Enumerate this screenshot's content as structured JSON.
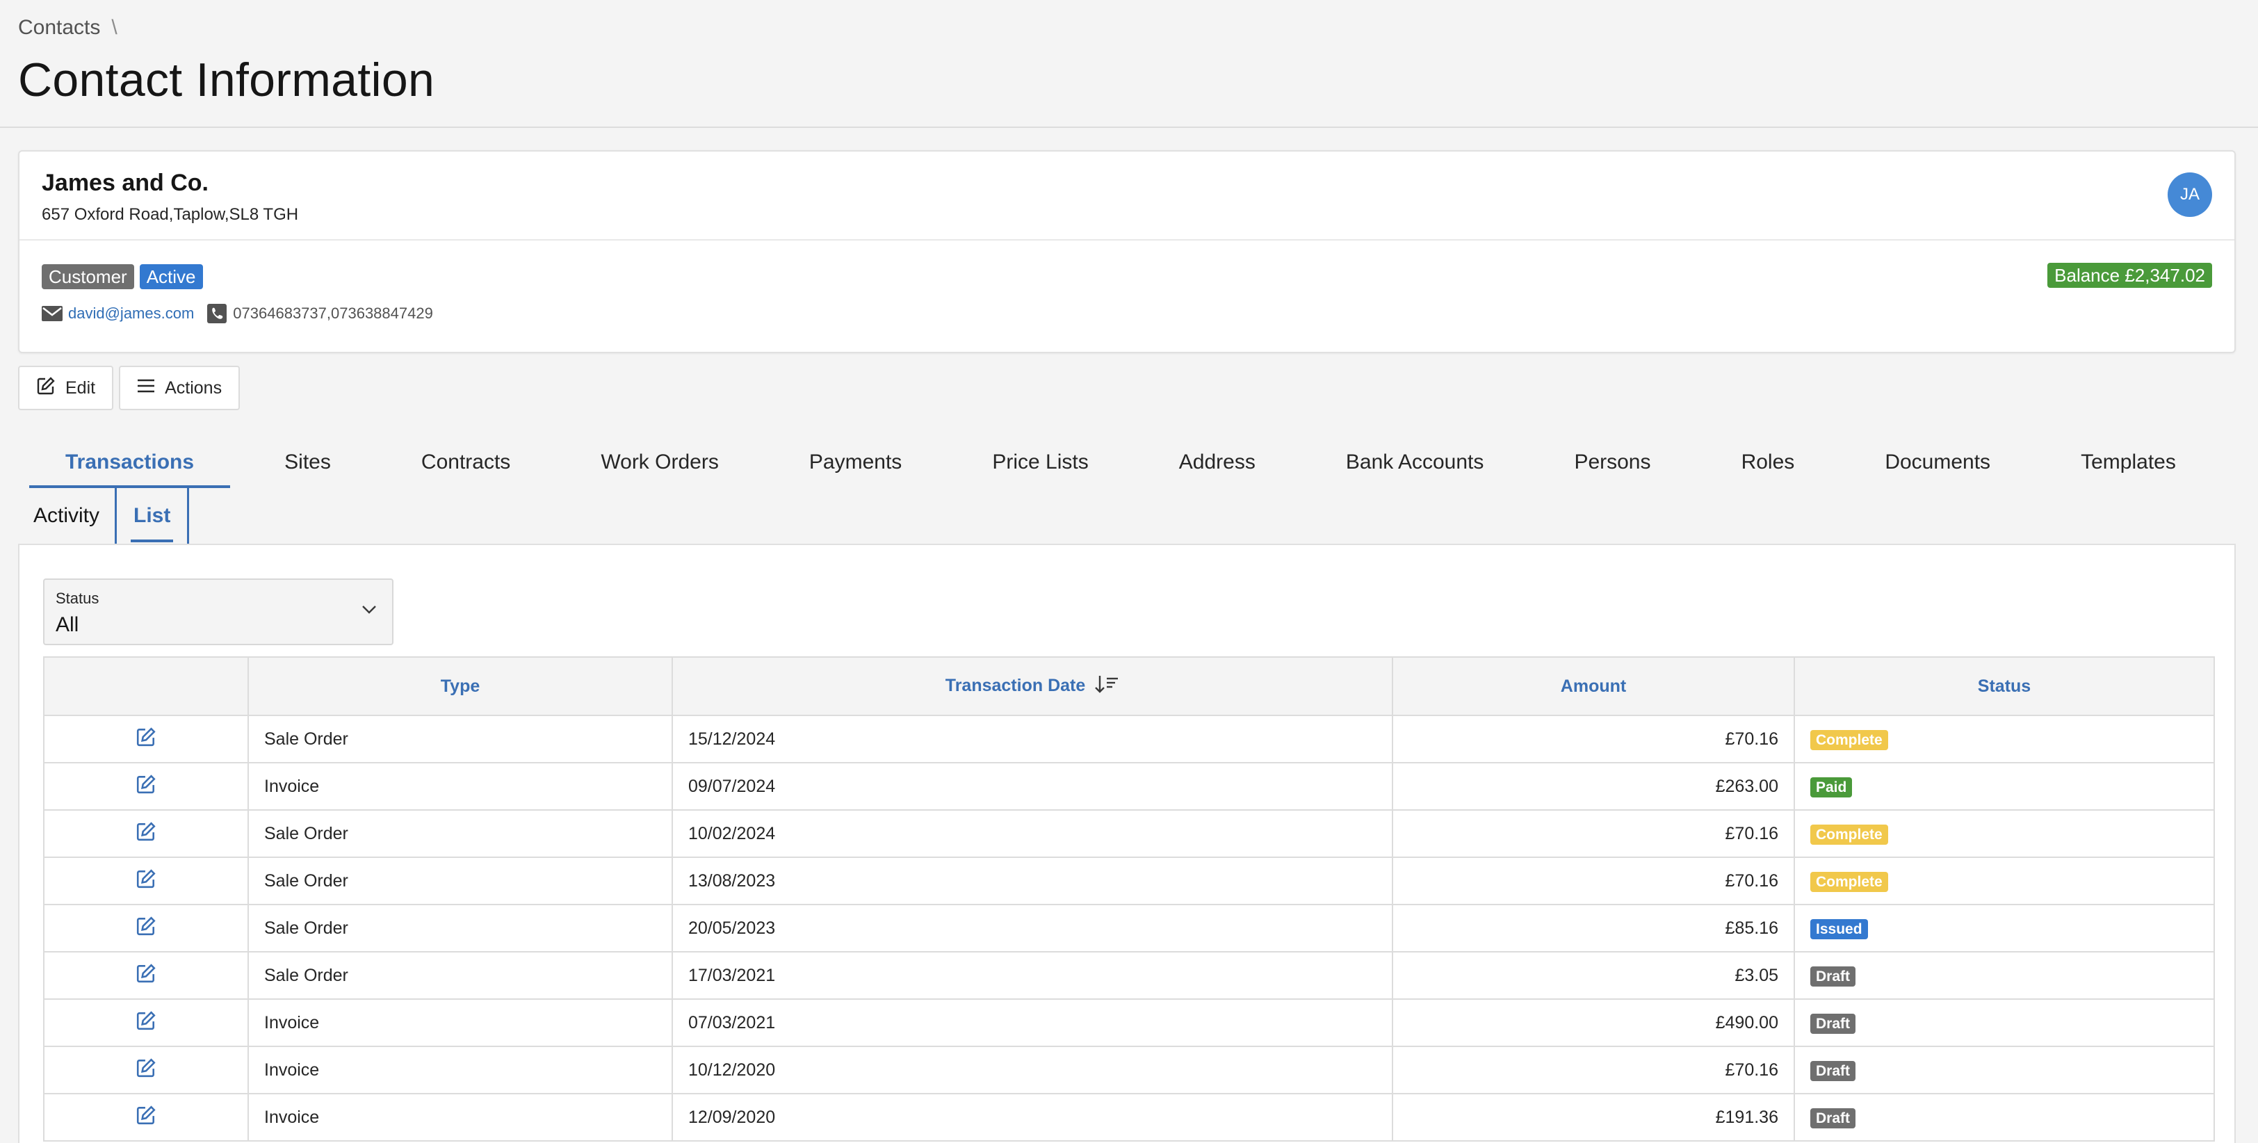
{
  "header": {
    "breadcrumb": [
      "Contacts"
    ],
    "breadcrumb_sep": "\\",
    "title": "Contact Information"
  },
  "contact": {
    "name": "James and Co.",
    "address": "657 Oxford Road,Taplow,SL8 TGH",
    "avatar_initials": "JA",
    "tags": [
      "Customer",
      "Active"
    ],
    "balance": "Balance £2,347.02",
    "email": "david@james.com",
    "phone": "07364683737,073638847429",
    "colors": {
      "customer": "#6f6f6f",
      "active": "#3379d0",
      "balance": "#4a9a3a",
      "avatar": "#4589d6"
    }
  },
  "actions": {
    "edit_label": "Edit",
    "actions_label": "Actions"
  },
  "tabs": [
    {
      "label": "Transactions",
      "selected": true
    },
    {
      "label": "Sites"
    },
    {
      "label": "Contracts"
    },
    {
      "label": "Work Orders"
    },
    {
      "label": "Payments"
    },
    {
      "label": "Price Lists"
    },
    {
      "label": "Address"
    },
    {
      "label": "Bank Accounts"
    },
    {
      "label": "Persons"
    },
    {
      "label": "Roles"
    },
    {
      "label": "Documents"
    },
    {
      "label": "Templates"
    }
  ],
  "subtabs": [
    {
      "label": "Activity"
    },
    {
      "label": "List",
      "selected": true
    }
  ],
  "filter": {
    "label": "Status",
    "value": "All"
  },
  "table": {
    "columns": [
      "",
      "Type",
      "Transaction Date",
      "Amount",
      "Status"
    ],
    "rows": [
      {
        "type": "Sale Order",
        "date": "15/12/2024",
        "amount": "£70.16",
        "status": "Complete",
        "status_color": "#f1c84b"
      },
      {
        "type": "Invoice",
        "date": "09/07/2024",
        "amount": "£263.00",
        "status": "Paid",
        "status_color": "#4a9a3a"
      },
      {
        "type": "Sale Order",
        "date": "10/02/2024",
        "amount": "£70.16",
        "status": "Complete",
        "status_color": "#f1c84b"
      },
      {
        "type": "Sale Order",
        "date": "13/08/2023",
        "amount": "£70.16",
        "status": "Complete",
        "status_color": "#f1c84b"
      },
      {
        "type": "Sale Order",
        "date": "20/05/2023",
        "amount": "£85.16",
        "status": "Issued",
        "status_color": "#3379d0"
      },
      {
        "type": "Sale Order",
        "date": "17/03/2021",
        "amount": "£3.05",
        "status": "Draft",
        "status_color": "#6f6f6f"
      },
      {
        "type": "Invoice",
        "date": "07/03/2021",
        "amount": "£490.00",
        "status": "Draft",
        "status_color": "#6f6f6f"
      },
      {
        "type": "Invoice",
        "date": "10/12/2020",
        "amount": "£70.16",
        "status": "Draft",
        "status_color": "#6f6f6f"
      },
      {
        "type": "Invoice",
        "date": "12/09/2020",
        "amount": "£191.36",
        "status": "Draft",
        "status_color": "#6f6f6f"
      }
    ]
  }
}
